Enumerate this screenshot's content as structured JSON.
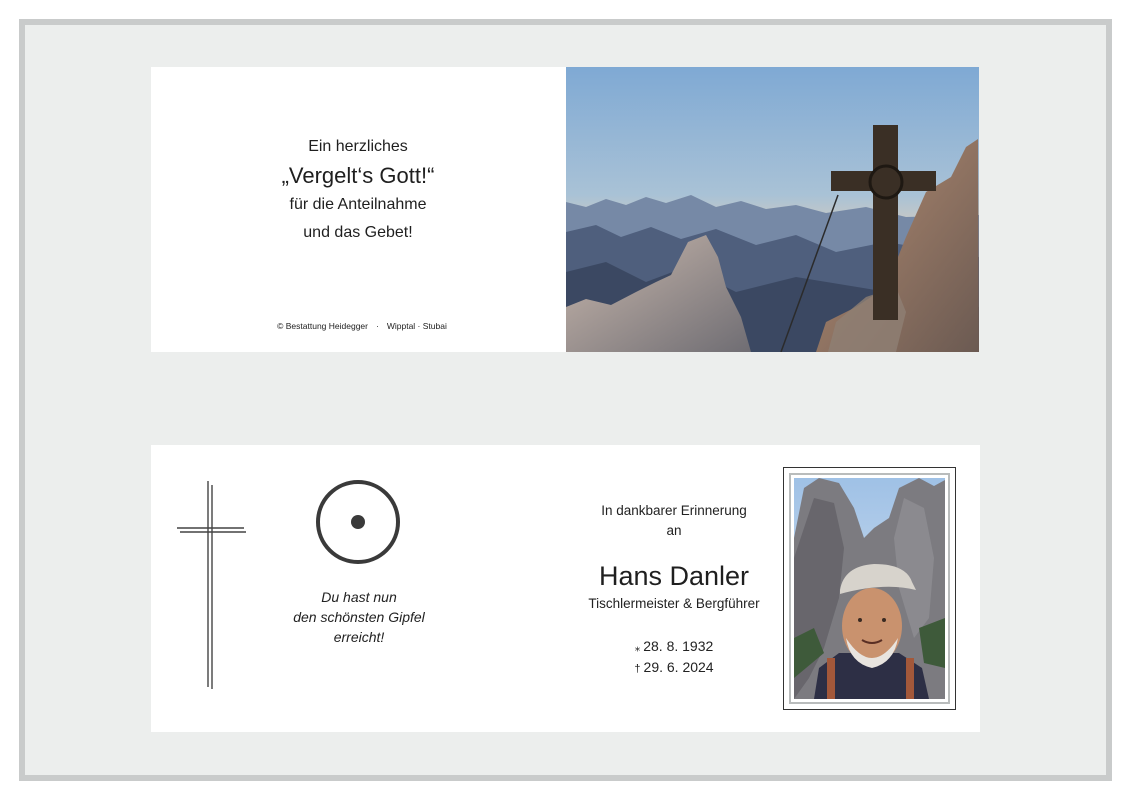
{
  "thanks_card": {
    "line1": "Ein herzliches",
    "line2": "„Vergelt‘s Gott!“",
    "line3": "für die Anteilnahme",
    "line4": "und das Gebet!",
    "copyright": "© Bestattung Heidegger",
    "region": "Wipptal · Stubai",
    "photo_icon": "summit-cross-photo"
  },
  "memorial_card": {
    "cross_icon": "cross-icon",
    "symbol_icon": "circle-dot-icon",
    "quote_line1": "Du hast nun",
    "quote_line2": "den schönsten Gipfel",
    "quote_line3": "erreicht!",
    "intro_line1": "In dankbarer Erinnerung",
    "intro_line2": "an",
    "name": "Hans Danler",
    "profession": "Tischlermeister & Bergführer",
    "birth_symbol": "⁎",
    "birth_date": "28. 8. 1932",
    "death_symbol": "†",
    "death_date": "29. 6. 2024",
    "portrait_icon": "portrait-photo"
  },
  "colors": {
    "background": "#eceeed",
    "frame": "#c9cbcb",
    "text": "#222222"
  }
}
